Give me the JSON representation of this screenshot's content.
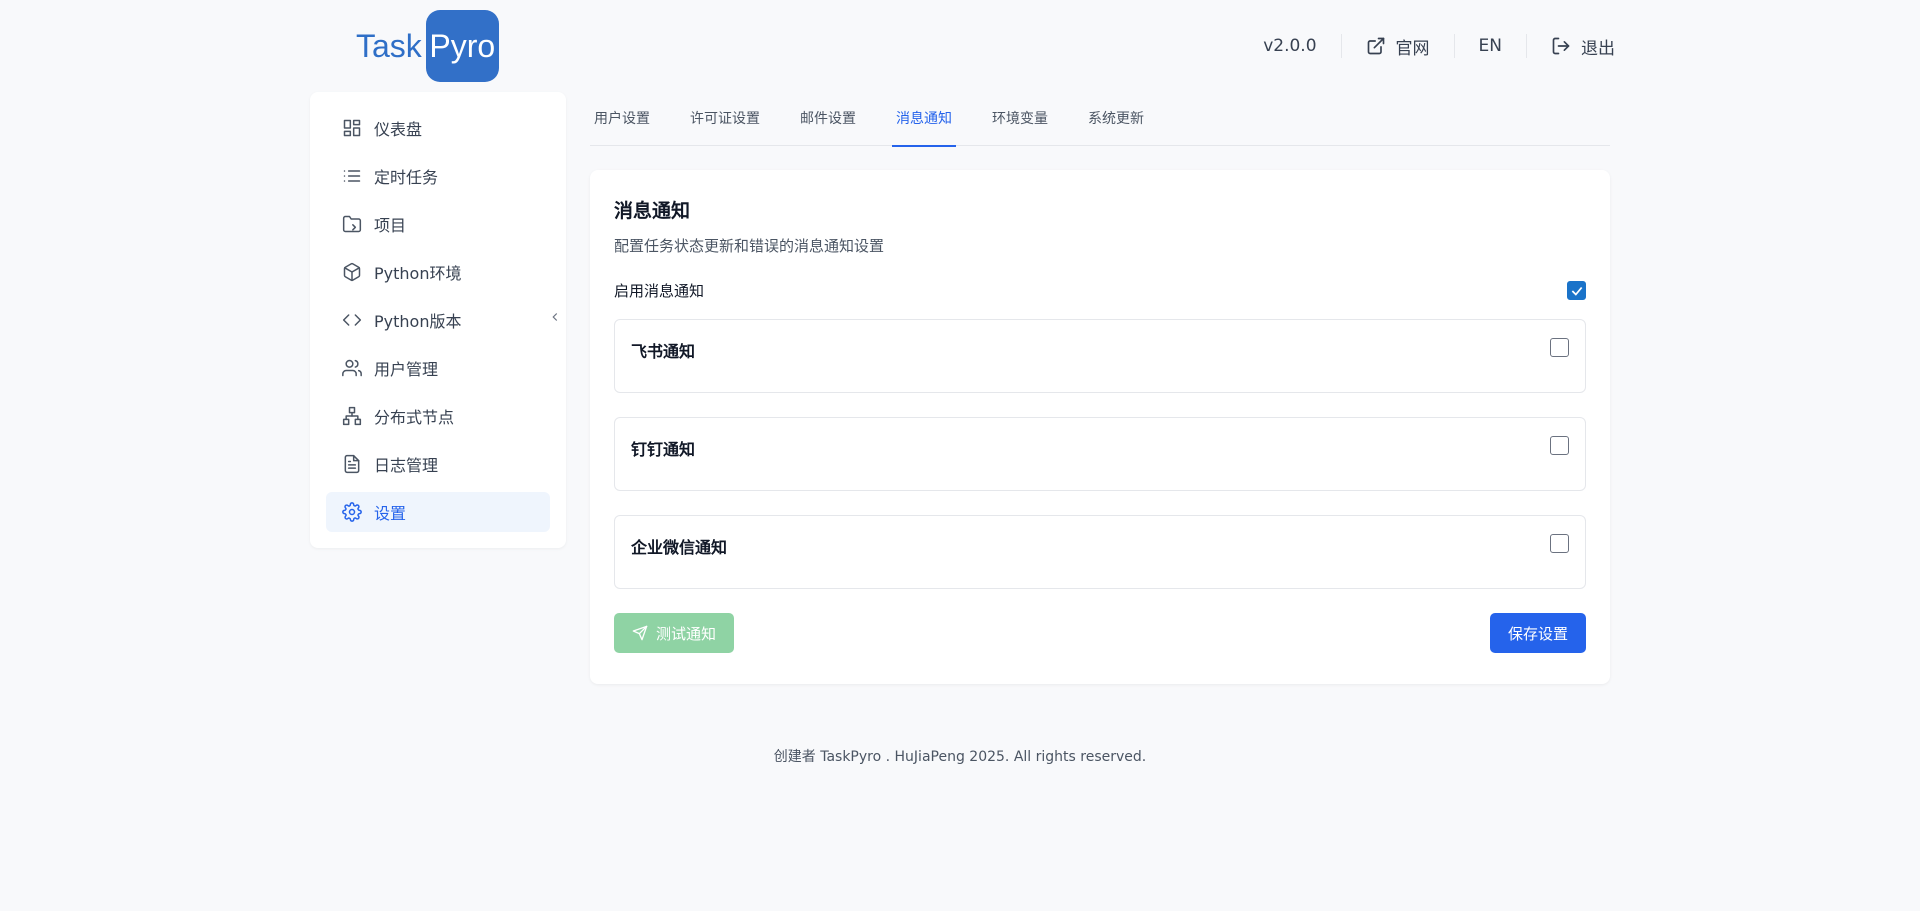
{
  "header": {
    "logo_task": "Task",
    "logo_pyro": "Pyro",
    "version": "v2.0.0",
    "website_label": "官网",
    "language_label": "EN",
    "logout_label": "退出"
  },
  "sidebar": {
    "items": [
      {
        "label": "仪表盘",
        "icon": "dashboard-icon"
      },
      {
        "label": "定时任务",
        "icon": "list-icon"
      },
      {
        "label": "项目",
        "icon": "folder-icon"
      },
      {
        "label": "Python环境",
        "icon": "package-icon"
      },
      {
        "label": "Python版本",
        "icon": "code-icon"
      },
      {
        "label": "用户管理",
        "icon": "users-icon"
      },
      {
        "label": "分布式节点",
        "icon": "network-icon"
      },
      {
        "label": "日志管理",
        "icon": "file-text-icon"
      },
      {
        "label": "设置",
        "icon": "gear-icon"
      }
    ],
    "active_index": 8
  },
  "tabs": [
    {
      "label": "用户设置"
    },
    {
      "label": "许可证设置"
    },
    {
      "label": "邮件设置"
    },
    {
      "label": "消息通知"
    },
    {
      "label": "环境变量"
    },
    {
      "label": "系统更新"
    }
  ],
  "active_tab": 3,
  "card": {
    "title": "消息通知",
    "description": "配置任务状态更新和错误的消息通知设置",
    "enable_label": "启用消息通知",
    "enable_checked": true,
    "channels": [
      {
        "name": "飞书通知",
        "checked": false
      },
      {
        "name": "钉钉通知",
        "checked": false
      },
      {
        "name": "企业微信通知",
        "checked": false
      }
    ],
    "test_button": "测试通知",
    "save_button": "保存设置"
  },
  "footer": {
    "text": "创建者 TaskPyro . HuJiaPeng 2025. All rights reserved."
  },
  "colors": {
    "accent": "#2563eb",
    "logo_bg": "#3270c8",
    "test_button_bg": "#8fd3a4",
    "checkbox_checked": "#1a73c9"
  }
}
